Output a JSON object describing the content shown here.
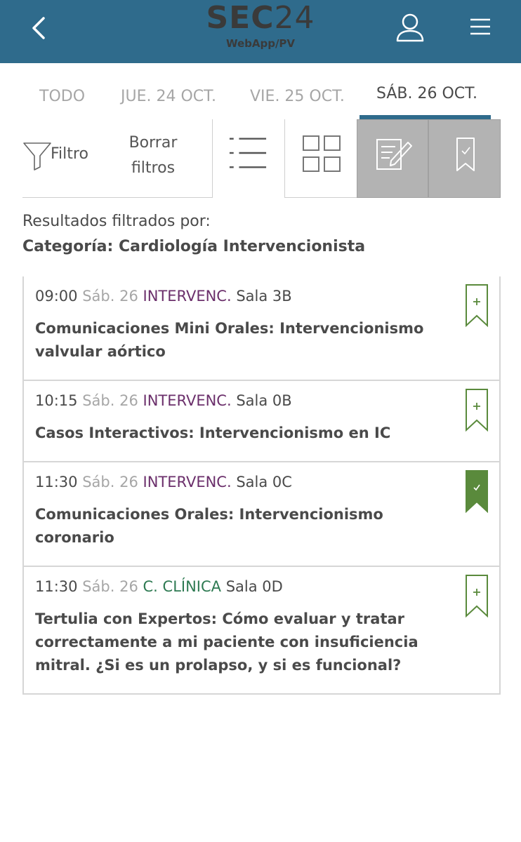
{
  "header": {
    "logo_bold": "SEC",
    "logo_thin": "24",
    "subtitle": "WebApp/PV"
  },
  "tabs": [
    {
      "label": "TODO",
      "active": false
    },
    {
      "label": "JUE. 24 OCT.",
      "active": false
    },
    {
      "label": "VIE. 25 OCT.",
      "active": false
    },
    {
      "label": "SÁB. 26 OCT.",
      "active": true
    }
  ],
  "toolbar": {
    "filter_label": "Filtro",
    "clear_line1": "Borrar",
    "clear_line2": "filtros"
  },
  "filter_summary": {
    "label": "Resultados filtrados por:",
    "category": "Categoría: Cardiología Intervencionista"
  },
  "sessions": [
    {
      "time": "09:00",
      "day": "Sáb. 26",
      "category": "INTERVENC.",
      "category_type": "interv",
      "room": "Sala 3B",
      "title": "Comunicaciones Mini Orales: Intervencionismo valvular aórtico",
      "bookmarked": false
    },
    {
      "time": "10:15",
      "day": "Sáb. 26",
      "category": "INTERVENC.",
      "category_type": "interv",
      "room": "Sala 0B",
      "title": "Casos Interactivos: Intervencionismo en IC",
      "bookmarked": false
    },
    {
      "time": "11:30",
      "day": "Sáb. 26",
      "category": "INTERVENC.",
      "category_type": "interv",
      "room": "Sala 0C",
      "title": "Comunicaciones Orales: Intervencionismo coronario",
      "bookmarked": true
    },
    {
      "time": "11:30",
      "day": "Sáb. 26",
      "category": "C. CLÍNICA",
      "category_type": "clin",
      "room": "Sala 0D",
      "title": "Tertulia con Expertos: Cómo evaluar y tratar correctamente a mi paciente con insuficiencia mitral. ¿Si es un prolapso, y si es funcional?",
      "bookmarked": false
    }
  ],
  "colors": {
    "header_bg": "#2f6b8c",
    "category_interv": "#6b2f6b",
    "category_clin": "#2e7a52",
    "bookmark_green": "#5a8a3c"
  },
  "icons": [
    "back-chevron-icon",
    "user-icon",
    "hamburger-menu-icon",
    "filter-funnel-icon",
    "list-view-icon",
    "grid-view-icon",
    "notes-icon",
    "saved-bookmark-icon",
    "bookmark-add-icon",
    "bookmark-checked-icon"
  ]
}
